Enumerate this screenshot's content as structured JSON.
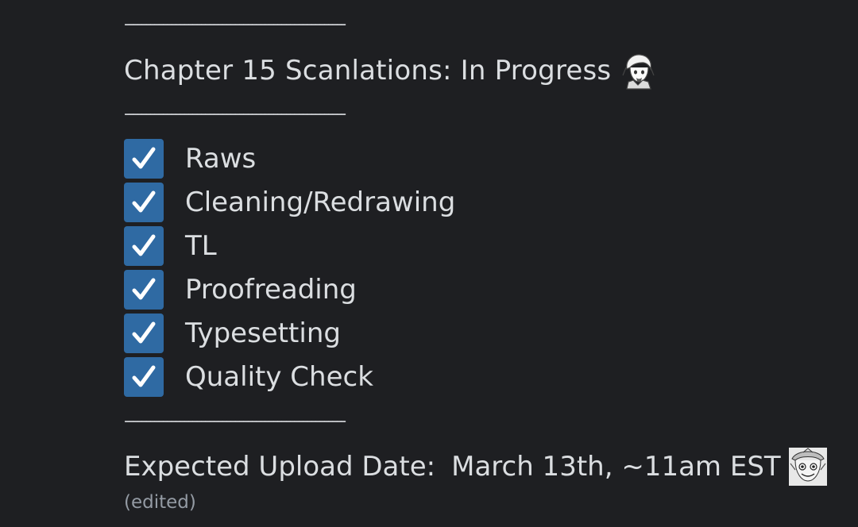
{
  "message": {
    "divider_top": "----------------------------------------------------",
    "title": "Chapter 15 Scanlations: In Progress",
    "title_emoji": "chibi-character-emoji",
    "divider_mid": "----------------------------------------------------",
    "checklist": [
      {
        "label": "Raws",
        "checked": true
      },
      {
        "label": "Cleaning/Redrawing",
        "checked": true
      },
      {
        "label": "TL",
        "checked": true
      },
      {
        "label": "Proofreading",
        "checked": true
      },
      {
        "label": "Typesetting",
        "checked": true
      },
      {
        "label": "Quality Check",
        "checked": true
      }
    ],
    "divider_bottom": "----------------------------------------------------",
    "upload_label": "Expected Upload Date:",
    "upload_value": "March 13th, ~11am EST",
    "upload_emoji": "manga-character-emoji",
    "edited": "(edited)"
  },
  "colors": {
    "background": "#1e1f22",
    "text": "#dbdee1",
    "checkbox": "#2f6aa3",
    "muted": "#949ba4"
  }
}
